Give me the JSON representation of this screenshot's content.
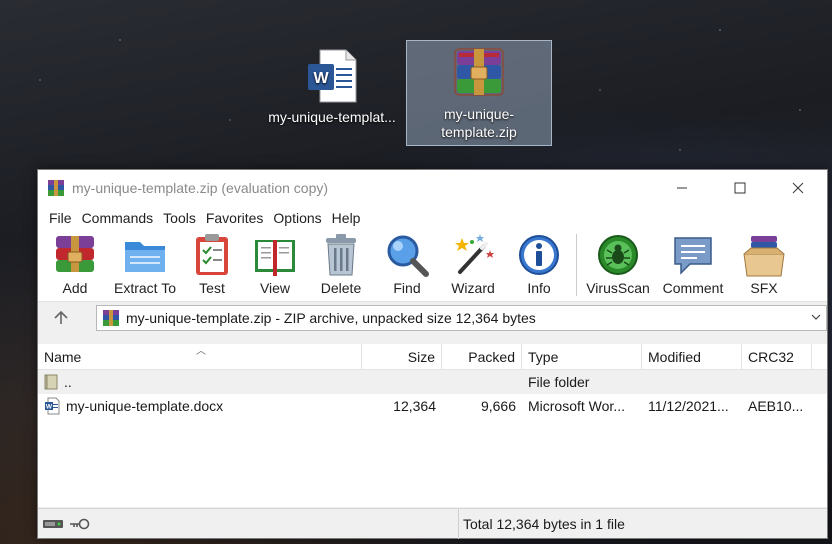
{
  "desktop": {
    "icons": [
      {
        "label": "my-unique-templat...",
        "icon": "word-document-icon"
      },
      {
        "label": "my-unique-template.zip",
        "icon": "winrar-archive-icon"
      }
    ]
  },
  "window": {
    "title": "my-unique-template.zip (evaluation copy)",
    "controls": [
      "minimize",
      "maximize",
      "close"
    ]
  },
  "menu": [
    "File",
    "Commands",
    "Tools",
    "Favorites",
    "Options",
    "Help"
  ],
  "toolbar": [
    {
      "label": "Add",
      "icon": "add-archive-icon"
    },
    {
      "label": "Extract To",
      "icon": "extract-folder-icon"
    },
    {
      "label": "Test",
      "icon": "test-clipboard-icon"
    },
    {
      "label": "View",
      "icon": "view-book-icon"
    },
    {
      "label": "Delete",
      "icon": "trash-icon"
    },
    {
      "label": "Find",
      "icon": "magnifier-icon"
    },
    {
      "label": "Wizard",
      "icon": "wizard-wand-icon"
    },
    {
      "label": "Info",
      "icon": "info-icon"
    },
    {
      "label": "VirusScan",
      "icon": "virus-scan-icon"
    },
    {
      "label": "Comment",
      "icon": "comment-icon"
    },
    {
      "label": "SFX",
      "icon": "sfx-box-icon"
    }
  ],
  "address": {
    "text": "my-unique-template.zip - ZIP archive, unpacked size 12,364 bytes"
  },
  "columns": {
    "name": "Name",
    "size": "Size",
    "packed": "Packed",
    "type": "Type",
    "modified": "Modified",
    "crc": "CRC32"
  },
  "rows": [
    {
      "name": "..",
      "size": "",
      "packed": "",
      "type": "File folder",
      "modified": "",
      "crc": ""
    },
    {
      "name": "my-unique-template.docx",
      "size": "12,364",
      "packed": "9,666",
      "type": "Microsoft Wor...",
      "modified": "11/12/2021...",
      "crc": "AEB10..."
    }
  ],
  "status": {
    "text": "Total 12,364 bytes in 1 file"
  },
  "colors": {
    "word_blue": "#2b5797",
    "selection": "#aabed7",
    "rar_red": "#c0282d",
    "rar_blue": "#2f57a6",
    "rar_green": "#3a9a3a",
    "rar_purple": "#7b3f98"
  }
}
